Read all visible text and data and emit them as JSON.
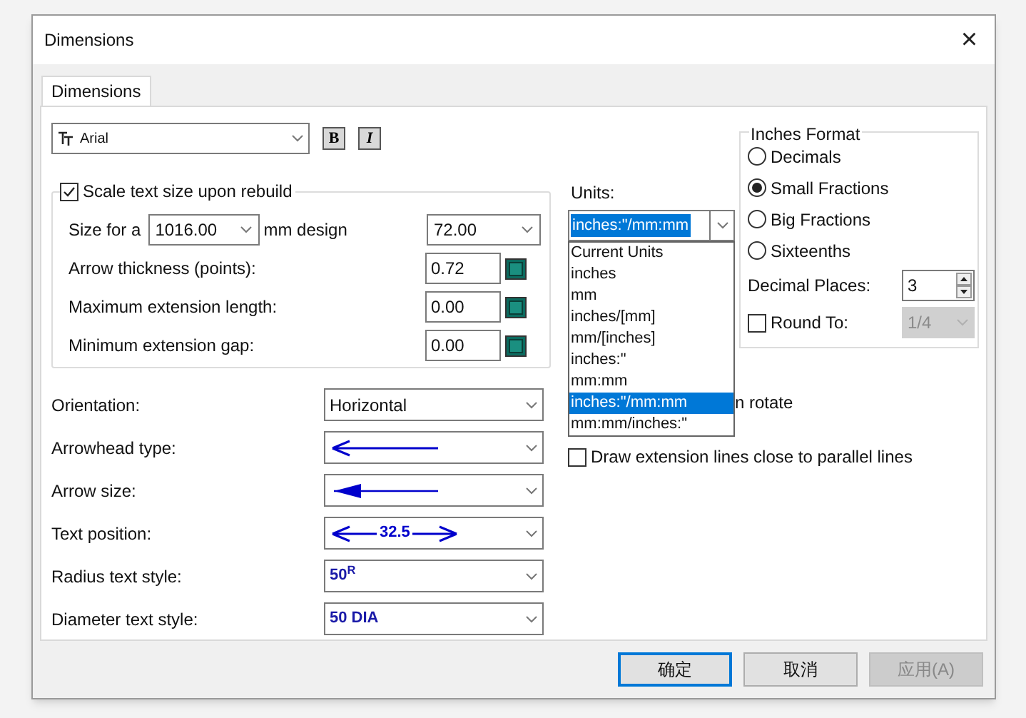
{
  "window": {
    "title": "Dimensions",
    "close": "×"
  },
  "tabs": [
    {
      "label": "Dimensions",
      "selected": true
    }
  ],
  "font": {
    "name": "Arial",
    "bold": "B",
    "italic": "I"
  },
  "scale": {
    "label": "Scale text size upon rebuild",
    "checked": true,
    "size_prefix": "Size for a",
    "size_value": "1016.00",
    "size_suffix": "mm design",
    "font_size": "72.00"
  },
  "fields": [
    {
      "label": "Arrow thickness (points):",
      "value": "0.72"
    },
    {
      "label": "Maximum extension length:",
      "value": "0.00"
    },
    {
      "label": "Minimum extension gap:",
      "value": "0.00"
    }
  ],
  "style_rows": [
    {
      "label": "Orientation:",
      "kind": "text",
      "value": "Horizontal"
    },
    {
      "label": "Arrowhead type:",
      "kind": "arrowhead"
    },
    {
      "label": "Arrow size:",
      "kind": "arrow_size"
    },
    {
      "label": "Text position:",
      "kind": "text_position",
      "value": "32.5"
    },
    {
      "label": "Radius text style:",
      "kind": "styled",
      "value": "50$^{R}$"
    },
    {
      "label": "Diameter text style:",
      "kind": "styled",
      "value": "50 DIA"
    }
  ],
  "units": {
    "label": "Units:",
    "value": "inches:\"/mm:mm",
    "options": [
      {
        "label": "Current Units",
        "selected": false
      },
      {
        "label": "inches",
        "selected": false
      },
      {
        "label": "mm",
        "selected": false
      },
      {
        "label": "inches/[mm]",
        "selected": false
      },
      {
        "label": "mm/[inches]",
        "selected": false
      },
      {
        "label": "inches:\"",
        "selected": false
      },
      {
        "label": "mm:mm",
        "selected": false
      },
      {
        "label": "inches:\"/mm:mm",
        "selected": true
      },
      {
        "label": "mm:mm/inches:\"",
        "selected": false
      }
    ]
  },
  "inches_format": {
    "title": "Inches Format",
    "options": [
      {
        "label": "Decimals",
        "selected": false
      },
      {
        "label": "Small Fractions",
        "selected": true
      },
      {
        "label": "Big Fractions",
        "selected": false
      },
      {
        "label": "Sixteenths",
        "selected": false
      }
    ],
    "decimal_places": {
      "label": "Decimal Places:",
      "value": "3"
    },
    "round_to": {
      "label": "Round To:",
      "checked": false,
      "value": "1/4"
    }
  },
  "rotate_text": "n rotate",
  "draw_ext": {
    "label": "Draw extension lines close to parallel lines",
    "checked": false
  },
  "buttons": [
    {
      "label": "确定",
      "kind": "default"
    },
    {
      "label": "取消",
      "kind": "normal"
    },
    {
      "label": "应用(A)",
      "kind": "disabled"
    }
  ]
}
